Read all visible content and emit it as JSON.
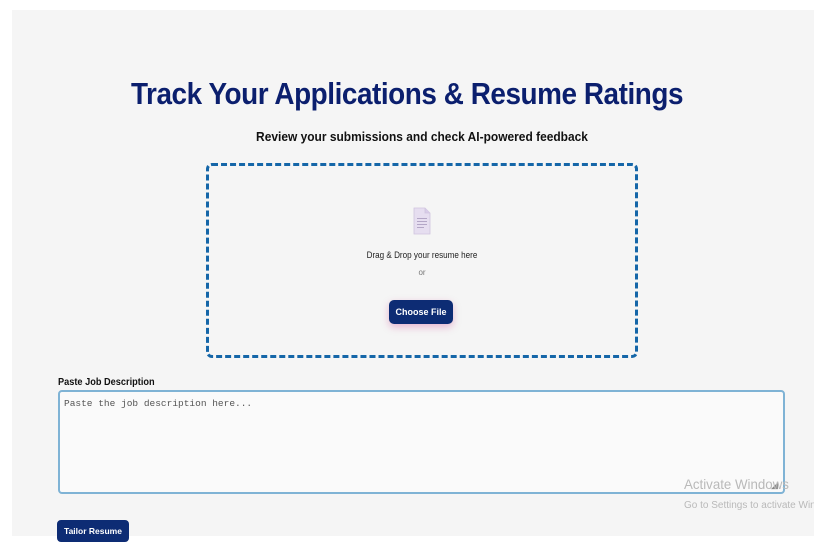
{
  "header": {
    "title": "Track Your Applications & Resume Ratings",
    "subtitle": "Review your submissions and check AI-powered feedback"
  },
  "upload": {
    "icon": "document-icon",
    "drag_text": "Drag & Drop your resume here",
    "or_text": "or",
    "choose_label": "Choose File"
  },
  "job_description": {
    "label": "Paste Job Description",
    "placeholder": "Paste the job description here...",
    "value": ""
  },
  "actions": {
    "tailor_label": "Tailor Resume"
  },
  "watermark": {
    "title": "Activate Windows",
    "subtitle": "Go to Settings to activate Windows."
  },
  "colors": {
    "title": "#0b1f6e",
    "button": "#0d2c74",
    "dropzone_border": "#1566a8",
    "textarea_border": "#7fb3d5",
    "page_background": "#f5f5f5"
  }
}
